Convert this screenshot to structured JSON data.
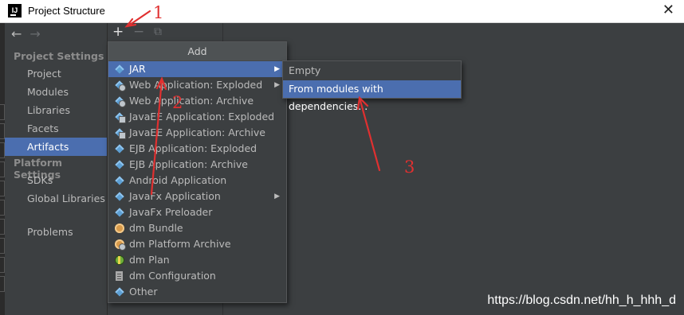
{
  "window": {
    "title": "Project Structure",
    "app_icon_text": "IJ",
    "close_glyph": "✕"
  },
  "nav": {
    "back_glyph": "←",
    "forward_glyph": "→"
  },
  "sidebar": {
    "section_project_settings": "Project Settings",
    "project_items": [
      "Project",
      "Modules",
      "Libraries",
      "Facets",
      "Artifacts"
    ],
    "section_platform_settings": "Platform Settings",
    "platform_items": [
      "SDKs",
      "Global Libraries"
    ],
    "problems": "Problems",
    "selected": "Artifacts"
  },
  "toolbar": {
    "add_glyph": "+",
    "remove_glyph": "−",
    "copy_glyph": "⧉"
  },
  "menu": {
    "header": "Add",
    "items": [
      {
        "label": "JAR",
        "icon": "jar-icon",
        "submenu": true,
        "selected": true
      },
      {
        "label": "Web Application: Exploded",
        "icon": "web-app-icon",
        "submenu": true
      },
      {
        "label": "Web Application: Archive",
        "icon": "web-app-icon"
      },
      {
        "label": "JavaEE Application: Exploded",
        "icon": "javaee-icon"
      },
      {
        "label": "JavaEE Application: Archive",
        "icon": "javaee-icon"
      },
      {
        "label": "EJB Application: Exploded",
        "icon": "ejb-icon"
      },
      {
        "label": "EJB Application: Archive",
        "icon": "ejb-icon"
      },
      {
        "label": "Android Application",
        "icon": "android-icon"
      },
      {
        "label": "JavaFx Application",
        "icon": "javafx-icon",
        "submenu": true
      },
      {
        "label": "JavaFx Preloader",
        "icon": "javafx-icon"
      },
      {
        "label": "dm Bundle",
        "icon": "dm-bundle-icon"
      },
      {
        "label": "dm Platform Archive",
        "icon": "dm-platform-icon"
      },
      {
        "label": "dm Plan",
        "icon": "dm-plan-icon"
      },
      {
        "label": "dm Configuration",
        "icon": "dm-config-icon"
      },
      {
        "label": "Other",
        "icon": "other-icon"
      }
    ],
    "arrow_glyph": "▶"
  },
  "submenu": {
    "items": [
      {
        "label": "Empty"
      },
      {
        "label": "From modules with dependencies...",
        "selected": true
      }
    ]
  },
  "annotations": {
    "n1": "1",
    "n2": "2",
    "n3": "3",
    "color": "#e03030"
  },
  "watermark": "https://blog.csdn.net/hh_h_hhh_d",
  "colors": {
    "selection": "#4b6eaf",
    "background": "#3c3f41",
    "text": "#bbbbbb"
  }
}
